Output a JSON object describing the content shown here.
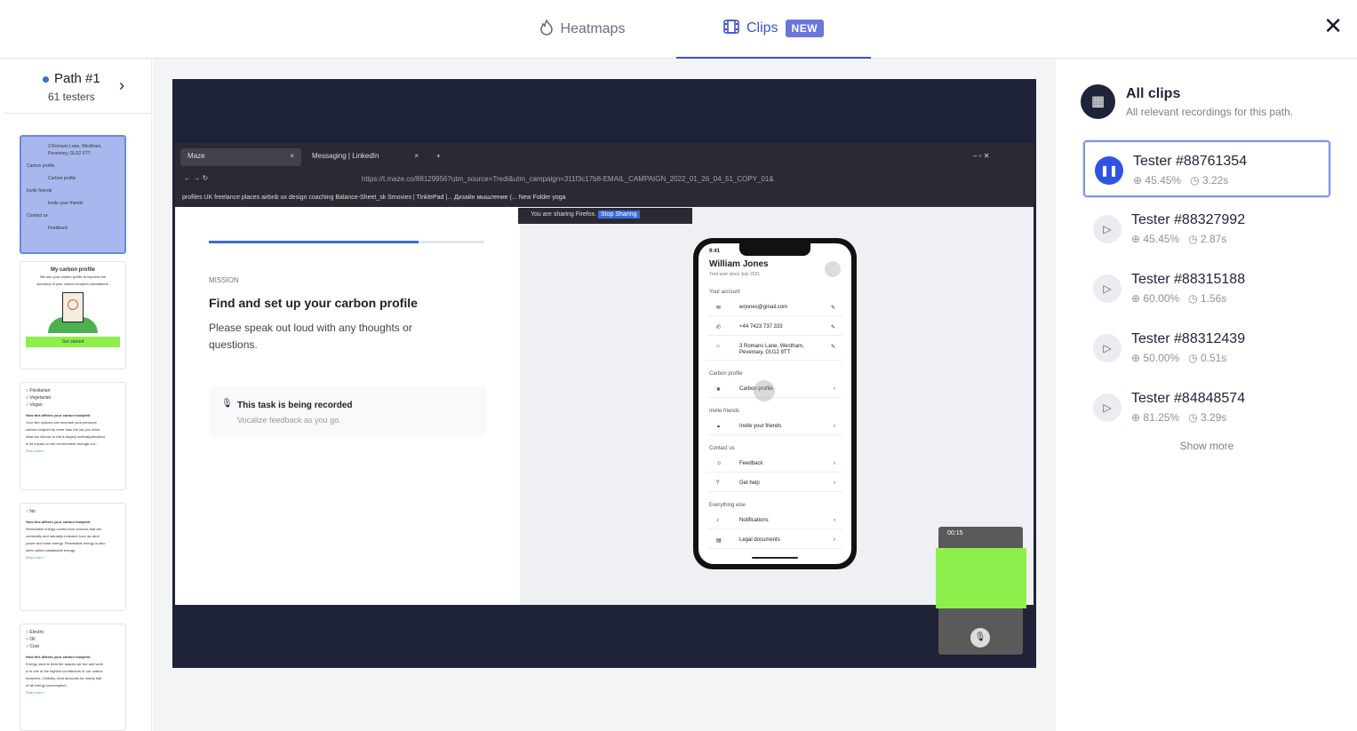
{
  "tabs": {
    "heatmaps": "Heatmaps",
    "clips": "Clips",
    "badge": "NEW"
  },
  "path": {
    "title": "Path #1",
    "testers": "61 testers"
  },
  "thumbnails": [
    {
      "lines": [
        "3 Romans Lane, Westham,",
        "Pevensey, GU12 6TT",
        "Carbon profile",
        "Carbon profile",
        "Invite friends",
        "Invite your friends",
        "Contact us",
        "Feedback"
      ]
    },
    {
      "lines": [
        "My carbon profile",
        "We use your carbon profile to improve the",
        "accuracy of your carbon footprint calculations.",
        "Get started"
      ]
    },
    {
      "lines": [
        "Flexitarian",
        "Vegetarian",
        "Vegan",
        "How this affects your carbon footprint",
        "Your diet choices can increase your personal",
        "carbon footprint by more than the car you drive,",
        "what we choose to eat is largely underappreciated",
        "in its impact on the environment through our...",
        "Read more"
      ]
    },
    {
      "lines": [
        "No",
        "How this affects your carbon footprint",
        "Renewable energy comes from sources that are",
        "constantly and naturally renewed such as wind",
        "power and solar energy. Renewable energy is also",
        "often called sustainable energy.",
        "Read more"
      ]
    },
    {
      "lines": [
        "Electric",
        "Oil",
        "Coal",
        "How this affects your carbon footprint",
        "Energy used to heat the spaces we live and work",
        "in is one of the highest contributors to our carbon",
        "footprints. Globally, heat accounts for nearly half",
        "of all energy consumption.",
        "Read more"
      ]
    }
  ],
  "browser": {
    "tab1": "Maze",
    "tab2": "Messaging | LinkedIn",
    "url": "https://t.maze.co/88129956?utm_source=Tredi&utm_campaign=311f3c17b8-EMAIL_CAMPAIGN_2022_01_26_04_51_COPY_01&",
    "bookmarks": "profiles   UK freelance   places   airbnb   ux design   coaching   Balance-Sheet_sk   Smovies | TinklePad |...   Дизайн мышление (...   New Folder   yoga",
    "sharing": "You are sharing Firefox.",
    "stop": "Stop Sharing"
  },
  "task": {
    "label": "MISSION",
    "title": "Find and set up your carbon profile",
    "desc": "Please speak out loud with any thoughts or questions.",
    "rec_title": "This task is being recorded",
    "rec_sub": "Vocalize feedback as you go.",
    "progress": 0.76
  },
  "phone": {
    "time": "9:41",
    "name": "William Jones",
    "since": "Tred user since July 2021",
    "your_account": "Your account",
    "email": "wrjones@gmail.com",
    "phone": "+44 7423 737 333",
    "address": "3 Romans Lane, Westham, Pevensey, GU12 8TT",
    "carbon_section": "Carbon profile",
    "carbon_item": "Carbon profile",
    "invite_section": "Invite friends",
    "invite_item": "Invite your friends",
    "contact_section": "Contact us",
    "feedback": "Feedback",
    "help": "Get help",
    "else_section": "Everything else",
    "notifications": "Notifications",
    "legal": "Legal documents"
  },
  "camera": {
    "time": "00:15"
  },
  "clips_panel": {
    "title": "All clips",
    "subtitle": "All relevant recordings for this path.",
    "show_more": "Show more",
    "items": [
      {
        "name": "Tester #88761354",
        "pct": "45.45%",
        "time": "3.22s"
      },
      {
        "name": "Tester #88327992",
        "pct": "45.45%",
        "time": "2.87s"
      },
      {
        "name": "Tester #88315188",
        "pct": "60.00%",
        "time": "1.56s"
      },
      {
        "name": "Tester #88312439",
        "pct": "50.00%",
        "time": "0.51s"
      },
      {
        "name": "Tester #84848574",
        "pct": "81.25%",
        "time": "3.29s"
      }
    ]
  },
  "colors": {
    "accent": "#3a4fd0",
    "play_active": "#2f54e3",
    "badge": "#6b75de",
    "camera_block": "#8def4b"
  }
}
